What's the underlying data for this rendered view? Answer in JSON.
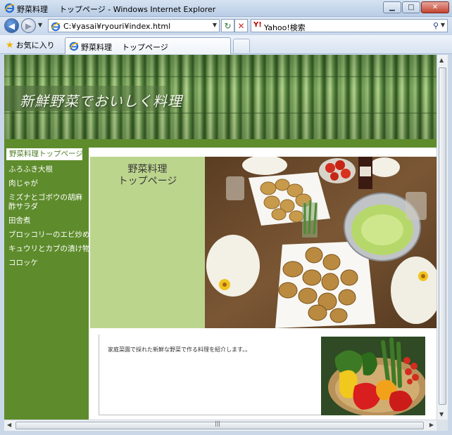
{
  "window": {
    "tab_name": "野菜料理",
    "title": "トップページ - Windows Internet Explorer",
    "minimize": "▁",
    "maximize": "□",
    "close": "✕"
  },
  "addressbar": {
    "url": "C:¥yasai¥ryouri¥index.html",
    "search_text": "Yahoo!検索",
    "refresh_glyph": "↻",
    "stop_glyph": "✕"
  },
  "favbar": {
    "favorites_label": "お気に入り",
    "tab_label": "野菜料理",
    "tab_title": "トップページ"
  },
  "page": {
    "site_title": "新鮮野菜でおいしく料理",
    "nav": [
      "野菜料理トップページ",
      "ふろふき大根",
      "肉じゃが",
      "ミズナとゴボウの胡麻酢サラダ",
      "田舎煮",
      "ブロッコリーのエビ炒め",
      "キュウリとカブの漬け物",
      "コロッケ"
    ],
    "hero_title": "野菜料理\nトップページ",
    "description": "家庭菜園で採れた新鮮な野菜で作る料理を紹介します。。"
  },
  "colors": {
    "sidebar_green": "#5e8c2c",
    "hero_label_bg": "#bcd58d",
    "active_nav_text": "#4e7d28"
  },
  "icons": {
    "ie_logo": "internet-explorer-icon",
    "favorites": "star-icon",
    "search": "magnifier-icon"
  }
}
